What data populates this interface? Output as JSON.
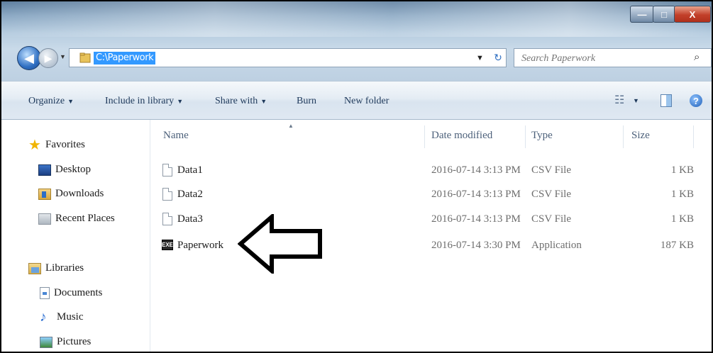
{
  "window": {
    "minimize_glyph": "—",
    "maximize_glyph": "□",
    "close_glyph": "X"
  },
  "address_bar": {
    "path": "C:\\Paperwork",
    "back_glyph": "◀",
    "forward_glyph": "▶",
    "dropdown_glyph": "▼",
    "refresh_glyph": "↻"
  },
  "search": {
    "placeholder": "Search Paperwork",
    "icon_glyph": "⌕"
  },
  "toolbar": {
    "organize": "Organize",
    "include_in_library": "Include in library",
    "share_with": "Share with",
    "burn": "Burn",
    "new_folder": "New folder",
    "dropdown_glyph": "▼",
    "view_glyph": "☷",
    "help_glyph": "?"
  },
  "nav": {
    "favorites": "Favorites",
    "desktop": "Desktop",
    "downloads": "Downloads",
    "recent_places": "Recent Places",
    "libraries": "Libraries",
    "documents": "Documents",
    "music": "Music",
    "pictures": "Pictures",
    "star_glyph": "★",
    "music_glyph": "♪"
  },
  "columns": {
    "name": "Name",
    "date_modified": "Date modified",
    "type": "Type",
    "size": "Size",
    "sort_glyph": "▲"
  },
  "files": [
    {
      "name": "Data1",
      "date": "2016-07-14 3:13 PM",
      "type": "CSV File",
      "size": "1 KB"
    },
    {
      "name": "Data2",
      "date": "2016-07-14 3:13 PM",
      "type": "CSV File",
      "size": "1 KB"
    },
    {
      "name": "Data3",
      "date": "2016-07-14 3:13 PM",
      "type": "CSV File",
      "size": "1 KB"
    },
    {
      "name": "Paperwork",
      "date": "2016-07-14 3:30 PM",
      "type": "Application",
      "size": "187 KB",
      "icon_text": "EXE"
    }
  ],
  "colors": {
    "address_highlight": "#3399ff",
    "command_text": "#1e395b",
    "close_button": "#c2402a"
  }
}
